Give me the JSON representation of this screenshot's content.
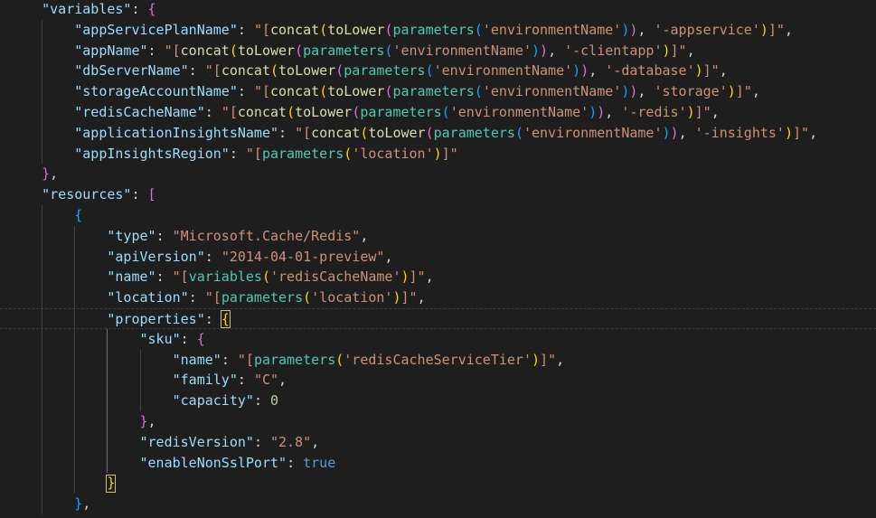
{
  "theme": {
    "background": "#1e1e1e",
    "key_color": "#9cdcfe",
    "string_color": "#ce9178",
    "function_color": "#dcdcaa",
    "parameter_color": "#4ec9b0",
    "keyword_color": "#569cd6",
    "number_color": "#b5cea8",
    "bracket_colors": [
      "#ffd700",
      "#da70d6",
      "#179fff"
    ]
  },
  "editor": {
    "language": "json",
    "current_line": 15,
    "lines": [
      {
        "tokens": [
          {
            "t": "    ",
            "c": "pl"
          },
          {
            "t": "\"variables\"",
            "c": "key"
          },
          {
            "t": ": ",
            "c": "pl"
          },
          {
            "t": "{",
            "c": "p2"
          }
        ]
      },
      {
        "tokens": [
          {
            "t": "        ",
            "c": "pl"
          },
          {
            "t": "\"appServicePlanName\"",
            "c": "key"
          },
          {
            "t": ": ",
            "c": "pl"
          },
          {
            "t": "\"[",
            "c": "str"
          },
          {
            "t": "concat",
            "c": "fn"
          },
          {
            "t": "(",
            "c": "p1"
          },
          {
            "t": "toLower",
            "c": "fn"
          },
          {
            "t": "(",
            "c": "p2"
          },
          {
            "t": "parameters",
            "c": "prm"
          },
          {
            "t": "(",
            "c": "p3"
          },
          {
            "t": "'environmentName'",
            "c": "str"
          },
          {
            "t": ")",
            "c": "p3"
          },
          {
            "t": ")",
            "c": "p2"
          },
          {
            "t": ", ",
            "c": "pl"
          },
          {
            "t": "'-appservice'",
            "c": "str"
          },
          {
            "t": ")",
            "c": "p1"
          },
          {
            "t": "]\"",
            "c": "str"
          },
          {
            "t": ",",
            "c": "pl"
          }
        ]
      },
      {
        "tokens": [
          {
            "t": "        ",
            "c": "pl"
          },
          {
            "t": "\"appName\"",
            "c": "key"
          },
          {
            "t": ": ",
            "c": "pl"
          },
          {
            "t": "\"[",
            "c": "str"
          },
          {
            "t": "concat",
            "c": "fn"
          },
          {
            "t": "(",
            "c": "p1"
          },
          {
            "t": "toLower",
            "c": "fn"
          },
          {
            "t": "(",
            "c": "p2"
          },
          {
            "t": "parameters",
            "c": "prm"
          },
          {
            "t": "(",
            "c": "p3"
          },
          {
            "t": "'environmentName'",
            "c": "str"
          },
          {
            "t": ")",
            "c": "p3"
          },
          {
            "t": ")",
            "c": "p2"
          },
          {
            "t": ", ",
            "c": "pl"
          },
          {
            "t": "'-clientapp'",
            "c": "str"
          },
          {
            "t": ")",
            "c": "p1"
          },
          {
            "t": "]\"",
            "c": "str"
          },
          {
            "t": ",",
            "c": "pl"
          }
        ]
      },
      {
        "tokens": [
          {
            "t": "        ",
            "c": "pl"
          },
          {
            "t": "\"dbServerName\"",
            "c": "key"
          },
          {
            "t": ": ",
            "c": "pl"
          },
          {
            "t": "\"[",
            "c": "str"
          },
          {
            "t": "concat",
            "c": "fn"
          },
          {
            "t": "(",
            "c": "p1"
          },
          {
            "t": "toLower",
            "c": "fn"
          },
          {
            "t": "(",
            "c": "p2"
          },
          {
            "t": "parameters",
            "c": "prm"
          },
          {
            "t": "(",
            "c": "p3"
          },
          {
            "t": "'environmentName'",
            "c": "str"
          },
          {
            "t": ")",
            "c": "p3"
          },
          {
            "t": ")",
            "c": "p2"
          },
          {
            "t": ", ",
            "c": "pl"
          },
          {
            "t": "'-database'",
            "c": "str"
          },
          {
            "t": ")",
            "c": "p1"
          },
          {
            "t": "]\"",
            "c": "str"
          },
          {
            "t": ",",
            "c": "pl"
          }
        ]
      },
      {
        "tokens": [
          {
            "t": "        ",
            "c": "pl"
          },
          {
            "t": "\"storageAccountName\"",
            "c": "key"
          },
          {
            "t": ": ",
            "c": "pl"
          },
          {
            "t": "\"[",
            "c": "str"
          },
          {
            "t": "concat",
            "c": "fn"
          },
          {
            "t": "(",
            "c": "p1"
          },
          {
            "t": "toLower",
            "c": "fn"
          },
          {
            "t": "(",
            "c": "p2"
          },
          {
            "t": "parameters",
            "c": "prm"
          },
          {
            "t": "(",
            "c": "p3"
          },
          {
            "t": "'environmentName'",
            "c": "str"
          },
          {
            "t": ")",
            "c": "p3"
          },
          {
            "t": ")",
            "c": "p2"
          },
          {
            "t": ", ",
            "c": "pl"
          },
          {
            "t": "'storage'",
            "c": "str"
          },
          {
            "t": ")",
            "c": "p1"
          },
          {
            "t": "]\"",
            "c": "str"
          },
          {
            "t": ",",
            "c": "pl"
          }
        ]
      },
      {
        "tokens": [
          {
            "t": "        ",
            "c": "pl"
          },
          {
            "t": "\"redisCacheName\"",
            "c": "key"
          },
          {
            "t": ": ",
            "c": "pl"
          },
          {
            "t": "\"[",
            "c": "str"
          },
          {
            "t": "concat",
            "c": "fn"
          },
          {
            "t": "(",
            "c": "p1"
          },
          {
            "t": "toLower",
            "c": "fn"
          },
          {
            "t": "(",
            "c": "p2"
          },
          {
            "t": "parameters",
            "c": "prm"
          },
          {
            "t": "(",
            "c": "p3"
          },
          {
            "t": "'environmentName'",
            "c": "str"
          },
          {
            "t": ")",
            "c": "p3"
          },
          {
            "t": ")",
            "c": "p2"
          },
          {
            "t": ", ",
            "c": "pl"
          },
          {
            "t": "'-redis'",
            "c": "str"
          },
          {
            "t": ")",
            "c": "p1"
          },
          {
            "t": "]\"",
            "c": "str"
          },
          {
            "t": ",",
            "c": "pl"
          }
        ]
      },
      {
        "tokens": [
          {
            "t": "        ",
            "c": "pl"
          },
          {
            "t": "\"applicationInsightsName\"",
            "c": "key"
          },
          {
            "t": ": ",
            "c": "pl"
          },
          {
            "t": "\"[",
            "c": "str"
          },
          {
            "t": "concat",
            "c": "fn"
          },
          {
            "t": "(",
            "c": "p1"
          },
          {
            "t": "toLower",
            "c": "fn"
          },
          {
            "t": "(",
            "c": "p2"
          },
          {
            "t": "parameters",
            "c": "prm"
          },
          {
            "t": "(",
            "c": "p3"
          },
          {
            "t": "'environmentName'",
            "c": "str"
          },
          {
            "t": ")",
            "c": "p3"
          },
          {
            "t": ")",
            "c": "p2"
          },
          {
            "t": ", ",
            "c": "pl"
          },
          {
            "t": "'-insights'",
            "c": "str"
          },
          {
            "t": ")",
            "c": "p1"
          },
          {
            "t": "]\"",
            "c": "str"
          },
          {
            "t": ",",
            "c": "pl"
          }
        ]
      },
      {
        "tokens": [
          {
            "t": "        ",
            "c": "pl"
          },
          {
            "t": "\"appInsightsRegion\"",
            "c": "key"
          },
          {
            "t": ": ",
            "c": "pl"
          },
          {
            "t": "\"[",
            "c": "str"
          },
          {
            "t": "parameters",
            "c": "prm"
          },
          {
            "t": "(",
            "c": "p1"
          },
          {
            "t": "'location'",
            "c": "str"
          },
          {
            "t": ")",
            "c": "p1"
          },
          {
            "t": "]\"",
            "c": "str"
          }
        ]
      },
      {
        "tokens": [
          {
            "t": "    ",
            "c": "pl"
          },
          {
            "t": "}",
            "c": "p2"
          },
          {
            "t": ",",
            "c": "pl"
          }
        ]
      },
      {
        "tokens": [
          {
            "t": "    ",
            "c": "pl"
          },
          {
            "t": "\"resources\"",
            "c": "key"
          },
          {
            "t": ": ",
            "c": "pl"
          },
          {
            "t": "[",
            "c": "p2"
          }
        ]
      },
      {
        "tokens": [
          {
            "t": "        ",
            "c": "pl"
          },
          {
            "t": "{",
            "c": "p3"
          }
        ]
      },
      {
        "tokens": [
          {
            "t": "            ",
            "c": "pl"
          },
          {
            "t": "\"type\"",
            "c": "key"
          },
          {
            "t": ": ",
            "c": "pl"
          },
          {
            "t": "\"Microsoft.Cache/Redis\"",
            "c": "str"
          },
          {
            "t": ",",
            "c": "pl"
          }
        ]
      },
      {
        "tokens": [
          {
            "t": "            ",
            "c": "pl"
          },
          {
            "t": "\"apiVersion\"",
            "c": "key"
          },
          {
            "t": ": ",
            "c": "pl"
          },
          {
            "t": "\"2014-04-01-preview\"",
            "c": "str"
          },
          {
            "t": ",",
            "c": "pl"
          }
        ]
      },
      {
        "tokens": [
          {
            "t": "            ",
            "c": "pl"
          },
          {
            "t": "\"name\"",
            "c": "key"
          },
          {
            "t": ": ",
            "c": "pl"
          },
          {
            "t": "\"[",
            "c": "str"
          },
          {
            "t": "variables",
            "c": "prm"
          },
          {
            "t": "(",
            "c": "p1"
          },
          {
            "t": "'redisCacheName'",
            "c": "str"
          },
          {
            "t": ")",
            "c": "p1"
          },
          {
            "t": "]\"",
            "c": "str"
          },
          {
            "t": ",",
            "c": "pl"
          }
        ]
      },
      {
        "tokens": [
          {
            "t": "            ",
            "c": "pl"
          },
          {
            "t": "\"location\"",
            "c": "key"
          },
          {
            "t": ": ",
            "c": "pl"
          },
          {
            "t": "\"[",
            "c": "str"
          },
          {
            "t": "parameters",
            "c": "prm"
          },
          {
            "t": "(",
            "c": "p1"
          },
          {
            "t": "'location'",
            "c": "str"
          },
          {
            "t": ")",
            "c": "p1"
          },
          {
            "t": "]\"",
            "c": "str"
          },
          {
            "t": ",",
            "c": "pl"
          }
        ]
      },
      {
        "tokens": [
          {
            "t": "            ",
            "c": "pl"
          },
          {
            "t": "\"properties\"",
            "c": "key"
          },
          {
            "t": ": ",
            "c": "pl"
          },
          {
            "t": "{",
            "c": "p1"
          }
        ]
      },
      {
        "tokens": [
          {
            "t": "                ",
            "c": "pl"
          },
          {
            "t": "\"sku\"",
            "c": "key"
          },
          {
            "t": ": ",
            "c": "pl"
          },
          {
            "t": "{",
            "c": "p2"
          }
        ]
      },
      {
        "tokens": [
          {
            "t": "                    ",
            "c": "pl"
          },
          {
            "t": "\"name\"",
            "c": "key"
          },
          {
            "t": ": ",
            "c": "pl"
          },
          {
            "t": "\"[",
            "c": "str"
          },
          {
            "t": "parameters",
            "c": "prm"
          },
          {
            "t": "(",
            "c": "p1"
          },
          {
            "t": "'redisCacheServiceTier'",
            "c": "str"
          },
          {
            "t": ")",
            "c": "p1"
          },
          {
            "t": "]\"",
            "c": "str"
          },
          {
            "t": ",",
            "c": "pl"
          }
        ]
      },
      {
        "tokens": [
          {
            "t": "                    ",
            "c": "pl"
          },
          {
            "t": "\"family\"",
            "c": "key"
          },
          {
            "t": ": ",
            "c": "pl"
          },
          {
            "t": "\"C\"",
            "c": "str"
          },
          {
            "t": ",",
            "c": "pl"
          }
        ]
      },
      {
        "tokens": [
          {
            "t": "                    ",
            "c": "pl"
          },
          {
            "t": "\"capacity\"",
            "c": "key"
          },
          {
            "t": ": ",
            "c": "pl"
          },
          {
            "t": "0",
            "c": "num"
          }
        ]
      },
      {
        "tokens": [
          {
            "t": "                ",
            "c": "pl"
          },
          {
            "t": "}",
            "c": "p2"
          },
          {
            "t": ",",
            "c": "pl"
          }
        ]
      },
      {
        "tokens": [
          {
            "t": "                ",
            "c": "pl"
          },
          {
            "t": "\"redisVersion\"",
            "c": "key"
          },
          {
            "t": ": ",
            "c": "pl"
          },
          {
            "t": "\"2.8\"",
            "c": "str"
          },
          {
            "t": ",",
            "c": "pl"
          }
        ]
      },
      {
        "tokens": [
          {
            "t": "                ",
            "c": "pl"
          },
          {
            "t": "\"enableNonSslPort\"",
            "c": "key"
          },
          {
            "t": ": ",
            "c": "pl"
          },
          {
            "t": "true",
            "c": "kw"
          }
        ]
      },
      {
        "tokens": [
          {
            "t": "            ",
            "c": "pl"
          },
          {
            "t": "}",
            "c": "p1"
          }
        ]
      },
      {
        "tokens": [
          {
            "t": "        ",
            "c": "pl"
          },
          {
            "t": "}",
            "c": "p3"
          },
          {
            "t": ",",
            "c": "pl"
          }
        ]
      }
    ]
  }
}
